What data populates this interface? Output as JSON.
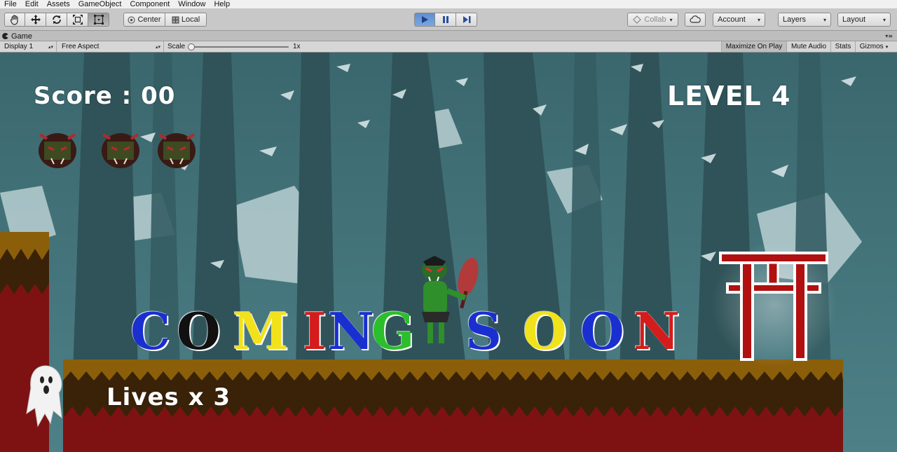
{
  "menu": {
    "items": [
      "File",
      "Edit",
      "Assets",
      "GameObject",
      "Component",
      "Window",
      "Help"
    ]
  },
  "toolbar": {
    "tools": [
      {
        "id": "hand",
        "icon": "hand-icon"
      },
      {
        "id": "move",
        "icon": "move-icon"
      },
      {
        "id": "rotate",
        "icon": "rotate-icon"
      },
      {
        "id": "scale",
        "icon": "scale-icon"
      },
      {
        "id": "rect",
        "icon": "rect-tool-icon"
      }
    ],
    "pivot_label": "Center",
    "space_label": "Local",
    "collab_label": "Collab",
    "account_label": "Account",
    "layers_label": "Layers",
    "layout_label": "Layout"
  },
  "game_tab": {
    "title": "Game"
  },
  "game_bar": {
    "display": "Display 1",
    "aspect": "Free Aspect",
    "scale_label": "Scale",
    "scale_value": "1x",
    "maximize_on_play": "Maximize On Play",
    "mute_audio": "Mute Audio",
    "stats": "Stats",
    "gizmos": "Gizmos"
  },
  "hud": {
    "score": "Score : 00",
    "level": "LEVEL 4",
    "lives": "Lives x 3",
    "enemy_heads_count_icons": [
      "monster-head-icon",
      "monster-head-icon",
      "monster-head-icon"
    ]
  },
  "banner": {
    "letters": [
      {
        "ch": "C",
        "color": "#1a2fd0"
      },
      {
        "ch": "O",
        "color": "#111111"
      },
      {
        "ch": "M",
        "color": "#f2e21a"
      },
      {
        "ch": "I",
        "color": "#d41c1c"
      },
      {
        "ch": "N",
        "color": "#1a2fd0"
      },
      {
        "ch": "G",
        "color": "#2bbf2b"
      },
      {
        "ch": "S",
        "color": "#1a2fd0"
      },
      {
        "ch": "O",
        "color": "#f2e21a"
      },
      {
        "ch": "O",
        "color": "#1a2fd0"
      },
      {
        "ch": "N",
        "color": "#d41c1c"
      }
    ]
  },
  "colors": {
    "sky": "#3f6e74",
    "ground_top": "#8b5e0a",
    "ground_mid": "#3a2208",
    "ground_bottom": "#7e1212",
    "torii": "#b01010",
    "play_accent": "#5e8fd0"
  }
}
